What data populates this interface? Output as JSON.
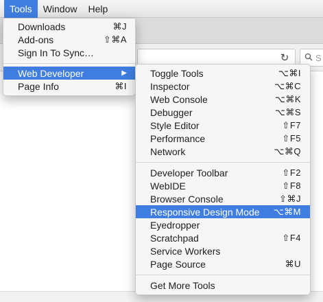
{
  "menubar": {
    "items": [
      "Tools",
      "Window",
      "Help"
    ],
    "active": "Tools",
    "accent": "#3f7ee0"
  },
  "toolbar": {
    "search_placeholder": "S",
    "reload_icon": "reload-icon",
    "search_icon": "search-icon"
  },
  "tools_menu": {
    "items": [
      {
        "label": "Downloads",
        "shortcut": "⌘J"
      },
      {
        "label": "Add-ons",
        "shortcut": "⇧⌘A"
      },
      {
        "label": "Sign In To Sync…",
        "shortcut": ""
      },
      {
        "label": "Web Developer",
        "shortcut": "▶"
      },
      {
        "label": "Page Info",
        "shortcut": "⌘I"
      }
    ],
    "highlighted": "Web Developer"
  },
  "devtools_menu": {
    "items": [
      {
        "label": "Toggle Tools",
        "shortcut": "⌥⌘I"
      },
      {
        "label": "Inspector",
        "shortcut": "⌥⌘C"
      },
      {
        "label": "Web Console",
        "shortcut": "⌥⌘K"
      },
      {
        "label": "Debugger",
        "shortcut": "⌥⌘S"
      },
      {
        "label": "Style Editor",
        "shortcut": "⇧F7"
      },
      {
        "label": "Performance",
        "shortcut": "⇧F5"
      },
      {
        "label": "Network",
        "shortcut": "⌥⌘Q"
      },
      {
        "label": "Developer Toolbar",
        "shortcut": "⇧F2"
      },
      {
        "label": "WebIDE",
        "shortcut": "⇧F8"
      },
      {
        "label": "Browser Console",
        "shortcut": "⇧⌘J"
      },
      {
        "label": "Responsive Design Mode",
        "shortcut": "⌥⌘M"
      },
      {
        "label": "Eyedropper",
        "shortcut": ""
      },
      {
        "label": "Scratchpad",
        "shortcut": "⇧F4"
      },
      {
        "label": "Service Workers",
        "shortcut": ""
      },
      {
        "label": "Page Source",
        "shortcut": "⌘U"
      },
      {
        "label": "Get More Tools",
        "shortcut": ""
      }
    ],
    "highlighted": "Responsive Design Mode"
  }
}
